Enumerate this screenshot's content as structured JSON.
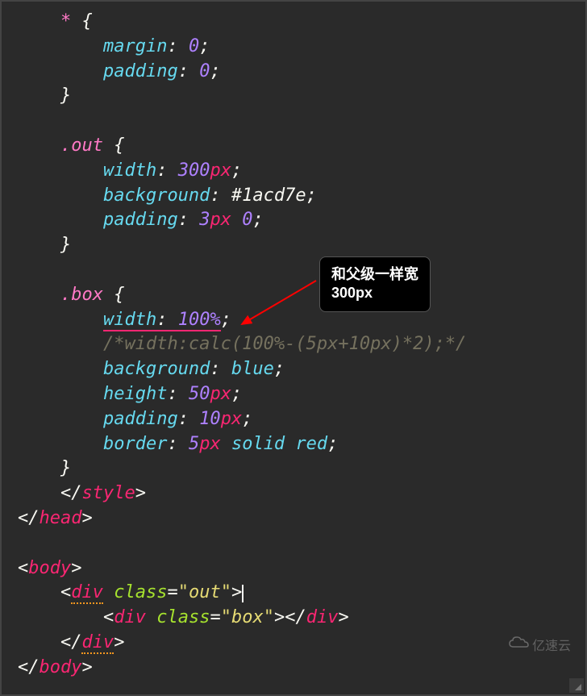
{
  "code": {
    "l1": "* {",
    "l2_prop": "margin",
    "l2_val": "0",
    "l3_prop": "padding",
    "l3_val": "0",
    "l4": "}",
    "l5": ".out {",
    "l6_prop": "width",
    "l6_num": "300",
    "l6_unit": "px",
    "l7_prop": "background",
    "l7_val": "#1acd7e",
    "l8_prop": "padding",
    "l8_num1": "3",
    "l8_unit1": "px",
    "l8_num2": "0",
    "l9": "}",
    "l10": ".box {",
    "l11_prop": "width",
    "l11_num": "100%",
    "l12_comment": "/*width:calc(100%-(5px+10px)*2);*/",
    "l13_prop": "background",
    "l13_val": "blue",
    "l14_prop": "height",
    "l14_num": "50",
    "l14_unit": "px",
    "l15_prop": "padding",
    "l15_num": "10",
    "l15_unit": "px",
    "l16_prop": "border",
    "l16_num": "5",
    "l16_unit": "px",
    "l16_kw1": "solid",
    "l16_kw2": "red",
    "l17": "}",
    "l18_tag": "style",
    "l19_tag": "head",
    "l20_tag": "body",
    "l21_tag": "div",
    "l21_attr": "class",
    "l21_val": "out",
    "l22_tag": "div",
    "l22_attr": "class",
    "l22_val": "box",
    "l23_tag": "div",
    "l24_tag": "body"
  },
  "tooltip": {
    "line1": "和父级一样宽",
    "line2": "300px"
  },
  "watermark": "亿速云"
}
